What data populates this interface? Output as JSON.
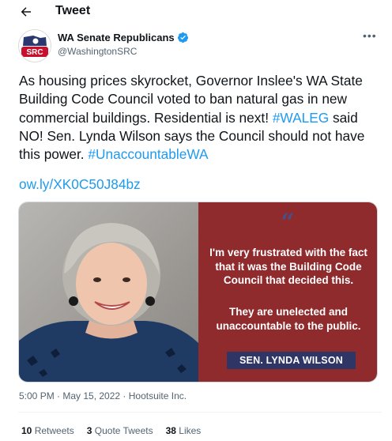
{
  "header": {
    "title": "Tweet"
  },
  "author": {
    "name": "WA Senate Republicans",
    "handle": "@WashingtonSRC",
    "avatar_text": "SRC"
  },
  "tweet": {
    "text_part1": "As housing prices skyrocket, Governor Inslee's WA State Building Code Council voted to ban natural gas in new commercial buildings. Residential is next! ",
    "hashtag1": "#WALEG",
    "text_part2": " said NO! Sen. Lynda Wilson says the Council should not have this power. ",
    "hashtag2": "#UnaccountableWA",
    "link": "ow.ly/XK0C50J84bz"
  },
  "media": {
    "quote_mark": "“",
    "quote_line1": "I'm very frustrated with the fact that it was the Building Code Council that decided this.",
    "quote_line2": "They are unelected and unaccountable to the public.",
    "attribution": "SEN. LYNDA WILSON"
  },
  "meta": {
    "timestamp": "5:00 PM · May 15, 2022 · Hootsuite Inc."
  },
  "stats": {
    "retweets_count": "10",
    "retweets_label": "Retweets",
    "quotes_count": "3",
    "quotes_label": "Quote Tweets",
    "likes_count": "38",
    "likes_label": "Likes"
  },
  "colors": {
    "accent": "#1d9bf0",
    "panel_red": "#8f2a2d",
    "panel_navy": "#2f3565",
    "avatar_red": "#c8102e",
    "avatar_navy": "#2b3870"
  },
  "icons": [
    "back-arrow-icon",
    "verified-badge-icon",
    "more-options-icon"
  ]
}
